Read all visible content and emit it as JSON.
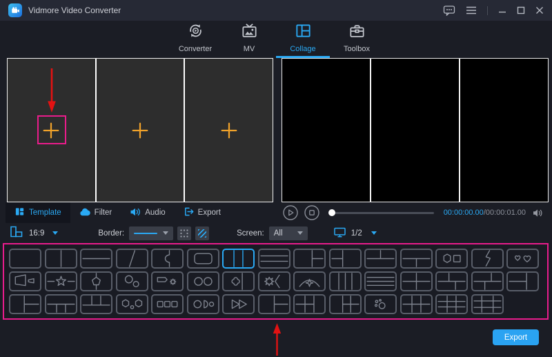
{
  "window": {
    "title": "Vidmore Video Converter"
  },
  "titlebar_icons": [
    "app-logo-icon",
    "feedback-icon",
    "menu-icon",
    "minimize-icon",
    "maximize-icon",
    "close-icon"
  ],
  "main_tabs": [
    {
      "label": "Converter",
      "icon": "converter-icon",
      "active": false
    },
    {
      "label": "MV",
      "icon": "mv-icon",
      "active": false
    },
    {
      "label": "Collage",
      "icon": "collage-icon",
      "active": true
    },
    {
      "label": "Toolbox",
      "icon": "toolbox-icon",
      "active": false
    }
  ],
  "editor": {
    "cells": 3,
    "cell_icon": "add-media-plus-icon",
    "annotations": [
      "red-arrow-down",
      "pink-highlight-box",
      "red-arrow-up",
      "pink-gallery-outline"
    ]
  },
  "sub_tabs": [
    {
      "label": "Template",
      "icon": "template-icon",
      "active": true
    },
    {
      "label": "Filter",
      "icon": "filter-icon",
      "active": false
    },
    {
      "label": "Audio",
      "icon": "audio-icon",
      "active": false
    },
    {
      "label": "Export",
      "icon": "export-icon",
      "active": false
    }
  ],
  "player": {
    "current_time": "00:00:00.00",
    "separator": "/",
    "total_time": "00:00:01.00",
    "icons": [
      "play-icon",
      "stop-icon",
      "volume-icon"
    ],
    "progress_percent": 0
  },
  "toolbar": {
    "ratio_value": "16:9",
    "border_label": "Border:",
    "screen_label": "Screen:",
    "screen_value": "All",
    "page_indicator": "1/2",
    "icons": [
      "aspect-ratio-icon",
      "border-color-dots-icon",
      "border-stripes-icon",
      "screen-monitor-icon"
    ]
  },
  "templates": {
    "selected": {
      "row": 0,
      "index": 6,
      "name": "three-columns"
    },
    "rows": [
      [
        "single",
        "two-columns",
        "two-rows",
        "diagonal-split",
        "curve-split",
        "rounded-frame",
        "three-columns",
        "three-rows",
        "big-left-split-right",
        "split-left-big-right",
        "split-top-big-bottom",
        "big-top-split-bottom",
        "hexagon-square",
        "lightning-split",
        "two-hearts"
      ],
      [
        "trapezoid-shapes",
        "star-split",
        "pentagon-split",
        "two-circles-diagonal",
        "banner-gear",
        "two-circles",
        "clover-split",
        "burst-bracket",
        "arch-sparkle",
        "four-columns",
        "four-rows",
        "grid-2x2",
        "grid-2x2-offset-left",
        "grid-2x2-offset-right",
        "split-left-column-right"
      ],
      [
        "big-left-two-right",
        "big-top-three-bottom",
        "three-top-big-bottom",
        "hexagons-dot",
        "three-squares",
        "circle-shapes",
        "forward-triangles",
        "column-split-right",
        "grid-2x3-left",
        "big-left-grid-right",
        "bubbles",
        "grid-2x3",
        "grid-3x3",
        "grid-3x3-frame"
      ]
    ]
  },
  "export_button_label": "Export",
  "colors": {
    "accent_blue": "#2aa9f4",
    "highlight_pink": "#ea1c8b",
    "arrow_red": "#e31212",
    "plus_orange": "#f0a22a",
    "titlebar_bg": "#262935",
    "app_bg": "#1b1d25"
  }
}
